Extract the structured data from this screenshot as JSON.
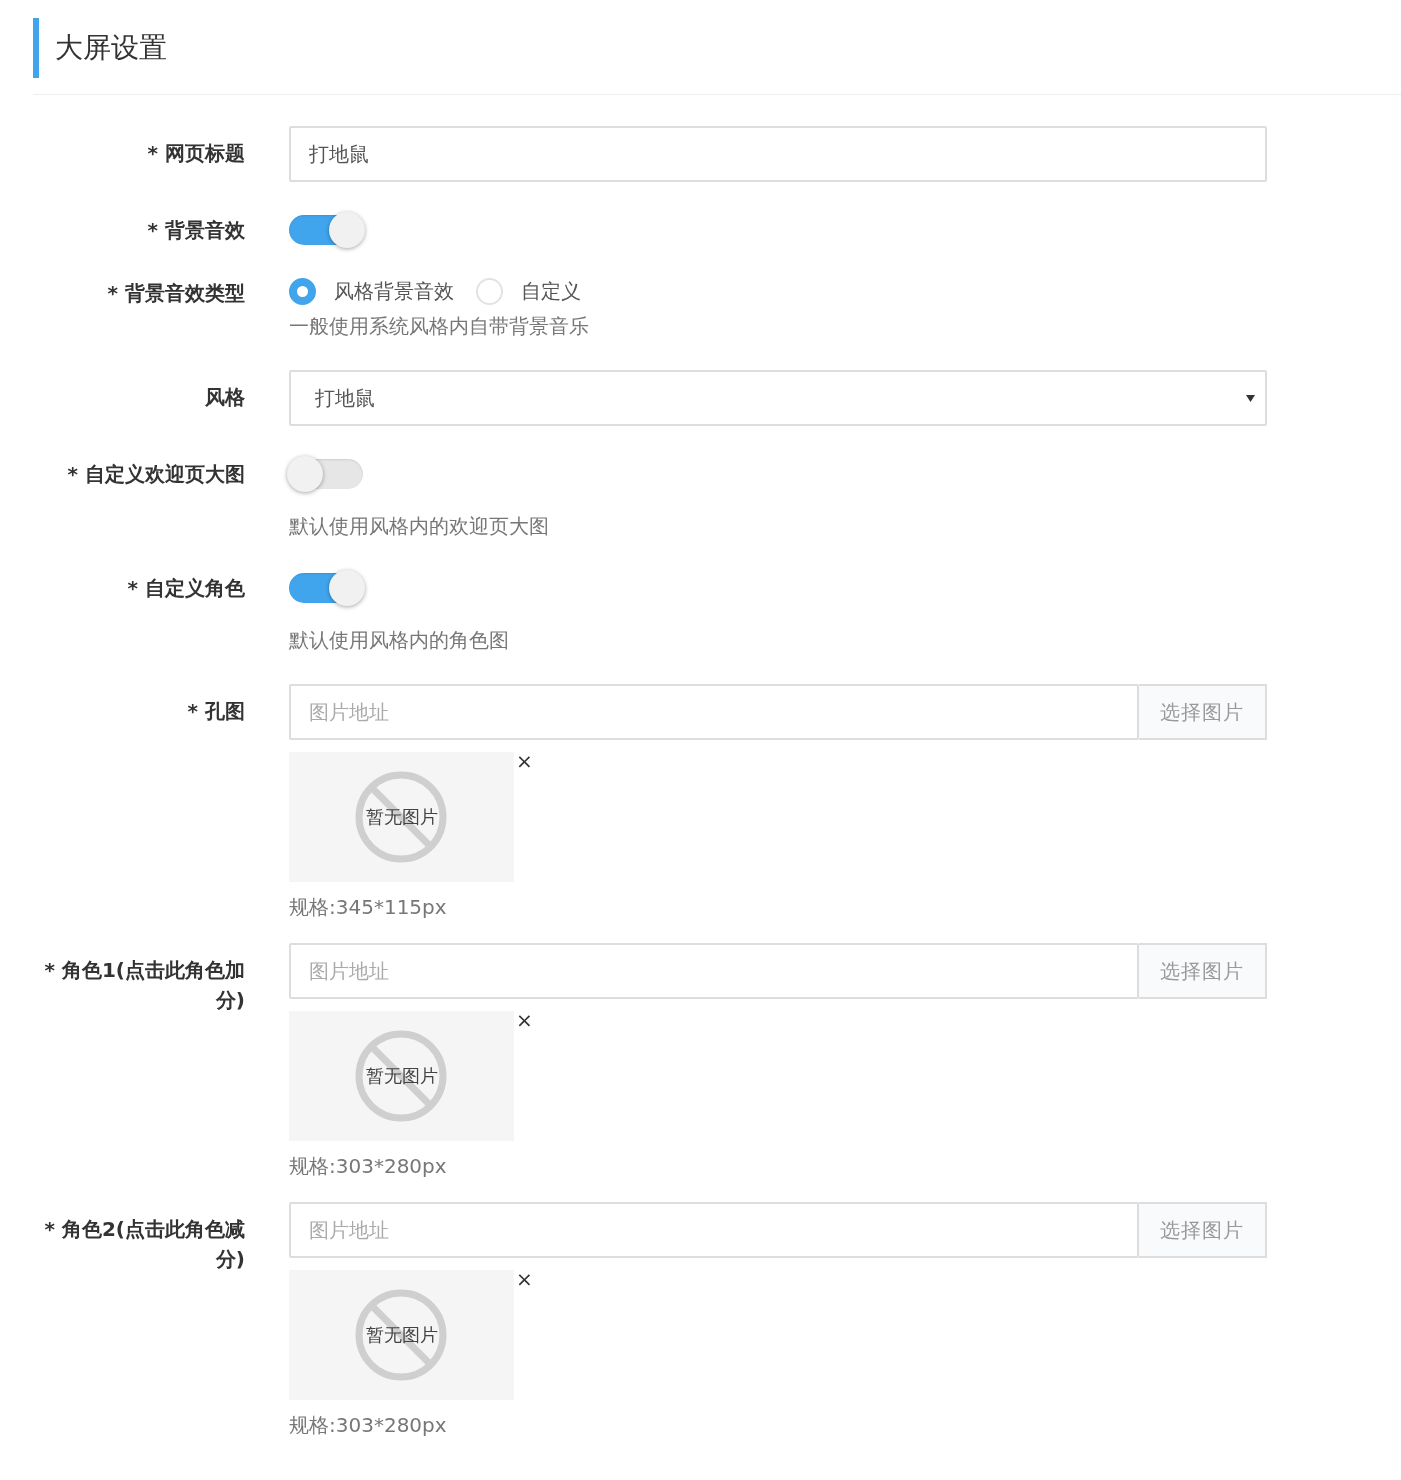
{
  "page_title": "大屏设置",
  "fields": [
    {
      "kind": "text",
      "label": "* 网页标题",
      "value": "打地鼠"
    },
    {
      "kind": "switch",
      "label": "* 背景音效",
      "on": true
    },
    {
      "kind": "radio",
      "label": "* 背景音效类型",
      "options": [
        {
          "label": "风格背景音效",
          "selected": true
        },
        {
          "label": "自定义",
          "selected": false
        }
      ],
      "hint": "一般使用系统风格内自带背景音乐"
    },
    {
      "kind": "select",
      "label": "风格",
      "value": "打地鼠"
    },
    {
      "kind": "switch",
      "label": "* 自定义欢迎页大图",
      "on": false,
      "hint": "默认使用风格内的欢迎页大图"
    },
    {
      "kind": "switch",
      "label": "* 自定义角色",
      "on": true,
      "hint": "默认使用风格内的角色图"
    },
    {
      "kind": "image",
      "label": "* 孔图",
      "placeholder": "图片地址",
      "button": "选择图片",
      "empty_text": "暂无图片",
      "close": "×",
      "spec": "规格:345*115px"
    },
    {
      "kind": "image",
      "label": "* 角色1(点击此角色加分)",
      "placeholder": "图片地址",
      "button": "选择图片",
      "empty_text": "暂无图片",
      "close": "×",
      "spec": "规格:303*280px"
    },
    {
      "kind": "image",
      "label": "* 角色2(点击此角色减分)",
      "placeholder": "图片地址",
      "button": "选择图片",
      "empty_text": "暂无图片",
      "close": "×",
      "spec": "规格:303*280px"
    }
  ]
}
